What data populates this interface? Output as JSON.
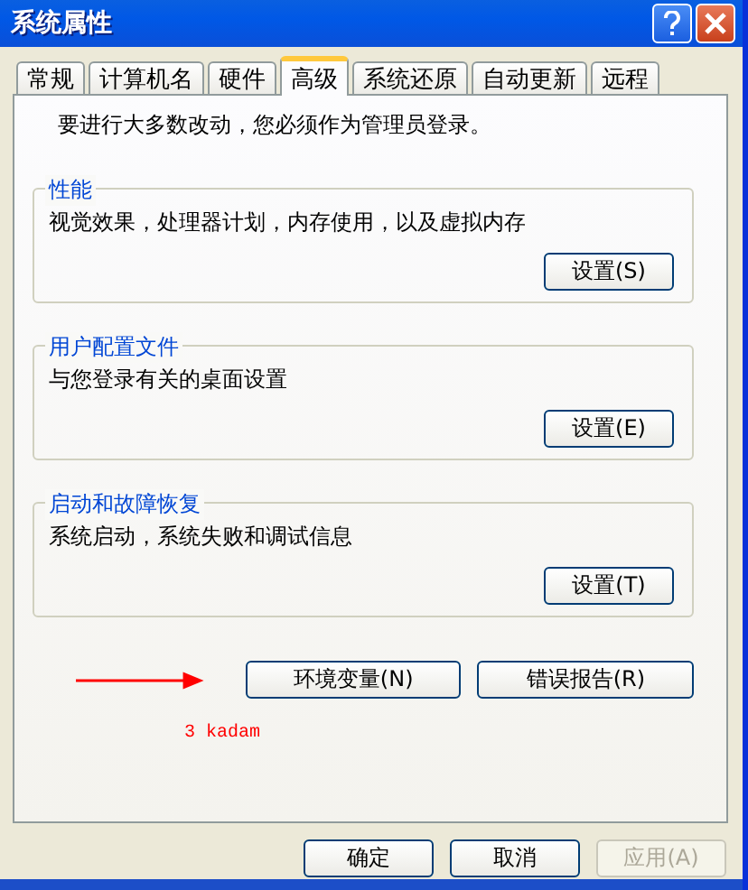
{
  "window": {
    "title": "系统属性"
  },
  "tabs": [
    {
      "label": "常规",
      "selected": false
    },
    {
      "label": "计算机名",
      "selected": false
    },
    {
      "label": "硬件",
      "selected": false
    },
    {
      "label": "高级",
      "selected": true
    },
    {
      "label": "系统还原",
      "selected": false
    },
    {
      "label": "自动更新",
      "selected": false
    },
    {
      "label": "远程",
      "selected": false
    }
  ],
  "notice": "要进行大多数改动，您必须作为管理员登录。",
  "groups": [
    {
      "title": "性能",
      "description": "视觉效果，处理器计划，内存使用，以及虚拟内存",
      "button": "设置(S)"
    },
    {
      "title": "用户配置文件",
      "description": "与您登录有关的桌面设置",
      "button": "设置(E)"
    },
    {
      "title": "启动和故障恢复",
      "description": "系统启动，系统失败和调试信息",
      "button": "设置(T)"
    }
  ],
  "extra_buttons": [
    "环境变量(N)",
    "错误报告(R)"
  ],
  "annotation": "3 kadam",
  "footer_buttons": [
    {
      "label": "确定",
      "disabled": false
    },
    {
      "label": "取消",
      "disabled": false
    },
    {
      "label": "应用(A)",
      "disabled": true
    }
  ]
}
